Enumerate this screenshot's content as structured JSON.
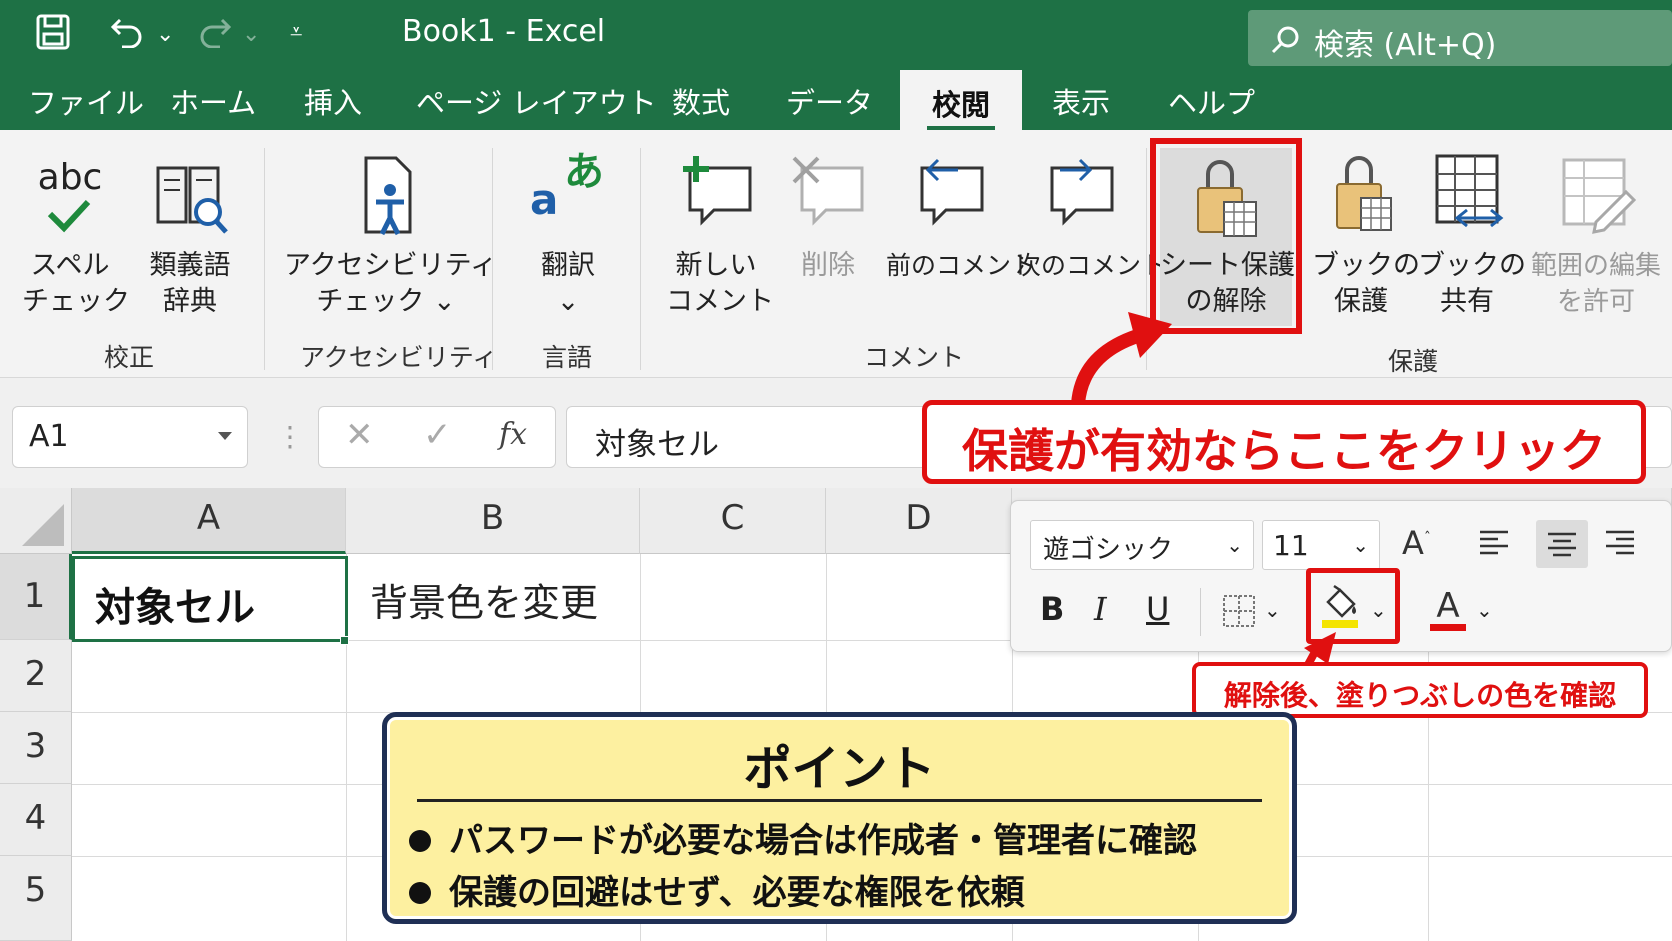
{
  "titlebar": {
    "title": "Book1  -  Excel",
    "search_text": "検索 (Alt+Q)"
  },
  "tabs": [
    "ファイル",
    "ホーム",
    "挿入",
    "ページ レイアウト",
    "数式",
    "データ",
    "校閲",
    "表示",
    "ヘルプ"
  ],
  "active_tab": "校閲",
  "ribbon": {
    "spell": {
      "icon_text": "abc",
      "line1": "スペル",
      "line2": "チェック"
    },
    "thesaurus": {
      "line1": "類義語",
      "line2": "辞典"
    },
    "group_proofing": "校正",
    "accessibility": {
      "line1": "アクセシビリティ",
      "line2": "チェック ⌄"
    },
    "group_accessibility": "アクセシビリティ",
    "translate": {
      "line1": "翻訳",
      "line2": "⌄",
      "icon_text": "あ"
    },
    "group_language": "言語",
    "new_comment": {
      "line1": "新しい",
      "line2": "コメント"
    },
    "delete": "削除",
    "prev_comment": "前のコメント",
    "next_comment": "次のコメント",
    "group_comment": "コメント",
    "unprotect_sheet": {
      "line1": "シート保護",
      "line2": "の解除"
    },
    "protect_book": {
      "line1": "ブックの",
      "line2": "保護"
    },
    "share_book": {
      "line1": "ブックの",
      "line2": "共有"
    },
    "allow_edit": {
      "line1": "範囲の編集",
      "line2": "を許可"
    },
    "group_protect": "保護"
  },
  "formula_bar": {
    "name_box": "A1",
    "fx": "fx",
    "content": "対象セル"
  },
  "columns": [
    "A",
    "B",
    "C",
    "D"
  ],
  "rows": [
    "1",
    "2",
    "3",
    "4",
    "5"
  ],
  "cells": {
    "A1": "対象セル",
    "B1": "背景色を変更"
  },
  "mini_toolbar": {
    "font": "遊ゴシック",
    "size": "11",
    "bold": "B",
    "italic": "I",
    "underline": "U",
    "font_color_letter": "A",
    "grow_letter": "A"
  },
  "callouts": {
    "protect": "保護が有効ならここをクリック",
    "fill": "解除後、塗りつぶしの色を確認"
  },
  "point": {
    "title": "ポイント",
    "items": [
      "パスワードが必要な場合は作成者・管理者に確認",
      "保護の回避はせず、必要な権限を依頼"
    ]
  },
  "colors": {
    "excel_green": "#1e7145",
    "highlight_red": "#e01010",
    "point_bg": "#fdf0a0",
    "fill_yellow": "#f4e400",
    "font_red": "#e01010"
  }
}
